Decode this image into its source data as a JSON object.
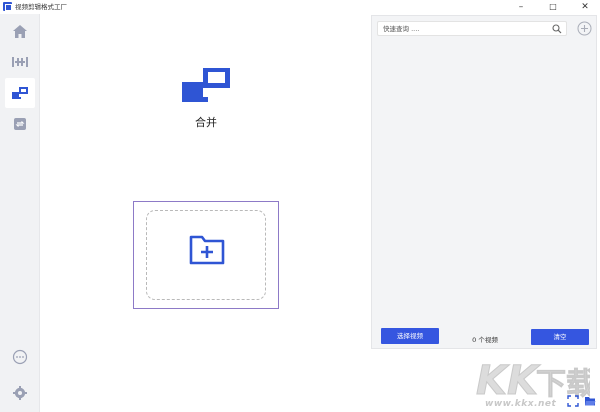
{
  "window": {
    "title": "视频剪辑格式工厂",
    "controls": [
      "–",
      "□",
      "✕"
    ]
  },
  "sidebar": {
    "items": [
      {
        "icon": "home-icon"
      },
      {
        "icon": "trim-icon"
      },
      {
        "icon": "merge-icon",
        "active": true
      },
      {
        "icon": "convert-icon"
      }
    ],
    "bottom": [
      {
        "icon": "more-icon"
      },
      {
        "icon": "settings-icon"
      }
    ]
  },
  "main": {
    "title": "合并",
    "drop_zone": {
      "icon": "add-folder-icon"
    }
  },
  "panel": {
    "search_placeholder": "快速查询 ....",
    "select_video_label": "选择视频",
    "video_count": "0 个视频",
    "clear_label": "清空"
  },
  "watermark": {
    "logo_text": "KK下载",
    "domain": "www.kkx.net"
  },
  "colors": {
    "accent": "#3556e0",
    "drop_border": "#8d7ac7",
    "sidebar_bg": "#f1f2f4",
    "panel_bg": "#f3f4f6"
  }
}
